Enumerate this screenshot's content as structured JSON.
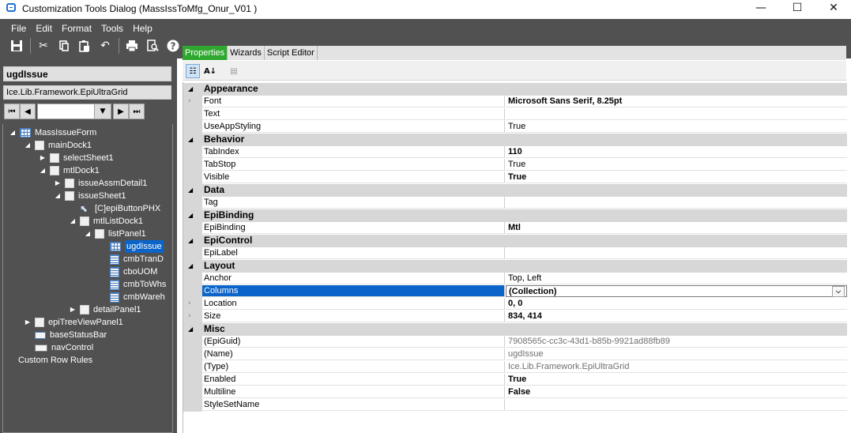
{
  "window": {
    "title": "Customization Tools Dialog  (MassIssToMfg_Onur_V01 )",
    "minimize": "—",
    "maximize": "☐",
    "close": "✕"
  },
  "menu": [
    "File",
    "Edit",
    "Format",
    "Tools",
    "Help"
  ],
  "toolbar_icons": [
    "save-icon",
    "cut-icon",
    "copy-icon",
    "paste-icon",
    "undo-icon",
    "print-icon",
    "print-preview-icon",
    "help-icon"
  ],
  "left": {
    "object_name": "ugdIssue",
    "object_type": "Ice.Lib.Framework.EpiUltraGrid",
    "nav": {
      "first": "⏮",
      "prev": "◀",
      "next": "▶",
      "last": "⏭",
      "drop": "▼"
    }
  },
  "tree": [
    {
      "label": "MassIssueForm",
      "level": 0,
      "expander": "◢",
      "icon": "form"
    },
    {
      "label": "mainDock1",
      "level": 1,
      "expander": "◢",
      "icon": "node"
    },
    {
      "label": "selectSheet1",
      "level": 2,
      "expander": "▶",
      "icon": "node"
    },
    {
      "label": "mtlDock1",
      "level": 2,
      "expander": "◢",
      "icon": "node"
    },
    {
      "label": "issueAssmDetail1",
      "level": 3,
      "expander": "▶",
      "icon": "node"
    },
    {
      "label": "issueSheet1",
      "level": 3,
      "expander": "◢",
      "icon": "node"
    },
    {
      "label": "[C]epiButtonPHX",
      "level": 4,
      "expander": "",
      "icon": "button"
    },
    {
      "label": "mtlListDock1",
      "level": 4,
      "expander": "◢",
      "icon": "node"
    },
    {
      "label": "listPanel1",
      "level": 5,
      "expander": "◢",
      "icon": "node"
    },
    {
      "label": "ugdIssue",
      "level": 6,
      "expander": "",
      "icon": "grid",
      "selected": true
    },
    {
      "label": "cmbTranD",
      "level": 6,
      "expander": "",
      "icon": "combo"
    },
    {
      "label": "cboUOM",
      "level": 6,
      "expander": "",
      "icon": "combo"
    },
    {
      "label": "cmbToWhs",
      "level": 6,
      "expander": "",
      "icon": "combo"
    },
    {
      "label": "cmbWareh",
      "level": 6,
      "expander": "",
      "icon": "combo"
    },
    {
      "label": "detailPanel1",
      "level": 4,
      "expander": "▶",
      "icon": "node"
    },
    {
      "label": "epiTreeViewPanel1",
      "level": 1,
      "expander": "▶",
      "icon": "node"
    },
    {
      "label": "baseStatusBar",
      "level": 1,
      "expander": "",
      "icon": "statusbar"
    },
    {
      "label": "navControl",
      "level": 1,
      "expander": "",
      "icon": "nav"
    },
    {
      "label": "Custom Row Rules",
      "level": 0,
      "expander": "",
      "icon": "none"
    }
  ],
  "tabs": [
    {
      "label": "Properties",
      "active": true
    },
    {
      "label": "Wizards",
      "active": false
    },
    {
      "label": "Script Editor",
      "active": false
    }
  ],
  "property_toolbar": {
    "categorized": "☷",
    "alphabetical": "A↓",
    "pages": "▤"
  },
  "properties": [
    {
      "type": "category",
      "label": "Appearance"
    },
    {
      "type": "prop",
      "name": "Font",
      "value": "Microsoft Sans Serif, 8.25pt",
      "bold": true,
      "expandable": true
    },
    {
      "type": "prop",
      "name": "Text",
      "value": ""
    },
    {
      "type": "prop",
      "name": "UseAppStyling",
      "value": "True"
    },
    {
      "type": "category",
      "label": "Behavior"
    },
    {
      "type": "prop",
      "name": "TabIndex",
      "value": "110",
      "bold": true
    },
    {
      "type": "prop",
      "name": "TabStop",
      "value": "True"
    },
    {
      "type": "prop",
      "name": "Visible",
      "value": "True",
      "bold": true
    },
    {
      "type": "category",
      "label": "Data"
    },
    {
      "type": "prop",
      "name": "Tag",
      "value": ""
    },
    {
      "type": "category",
      "label": "EpiBinding"
    },
    {
      "type": "prop",
      "name": "EpiBinding",
      "value": "Mtl",
      "bold": true
    },
    {
      "type": "category",
      "label": "EpiControl"
    },
    {
      "type": "prop",
      "name": "EpiLabel",
      "value": ""
    },
    {
      "type": "category",
      "label": "Layout"
    },
    {
      "type": "prop",
      "name": "Anchor",
      "value": "Top, Left"
    },
    {
      "type": "prop",
      "name": "Columns",
      "value": "(Collection)",
      "bold": true,
      "selected": true,
      "dropdown": "⌵"
    },
    {
      "type": "prop",
      "name": "Location",
      "value": "0, 0",
      "bold": true,
      "expandable": true
    },
    {
      "type": "prop",
      "name": "Size",
      "value": "834, 414",
      "bold": true,
      "expandable": true
    },
    {
      "type": "category",
      "label": "Misc"
    },
    {
      "type": "prop",
      "name": "(EpiGuid)",
      "value": "7908565c-cc3c-43d1-b85b-9921ad88fb89",
      "grey": true
    },
    {
      "type": "prop",
      "name": "(Name)",
      "value": "ugdIssue",
      "grey": true
    },
    {
      "type": "prop",
      "name": "(Type)",
      "value": "Ice.Lib.Framework.EpiUltraGrid",
      "grey": true
    },
    {
      "type": "prop",
      "name": "Enabled",
      "value": "True",
      "bold": true
    },
    {
      "type": "prop",
      "name": "Multiline",
      "value": "False",
      "bold": true
    },
    {
      "type": "prop",
      "name": "StyleSetName",
      "value": ""
    }
  ]
}
